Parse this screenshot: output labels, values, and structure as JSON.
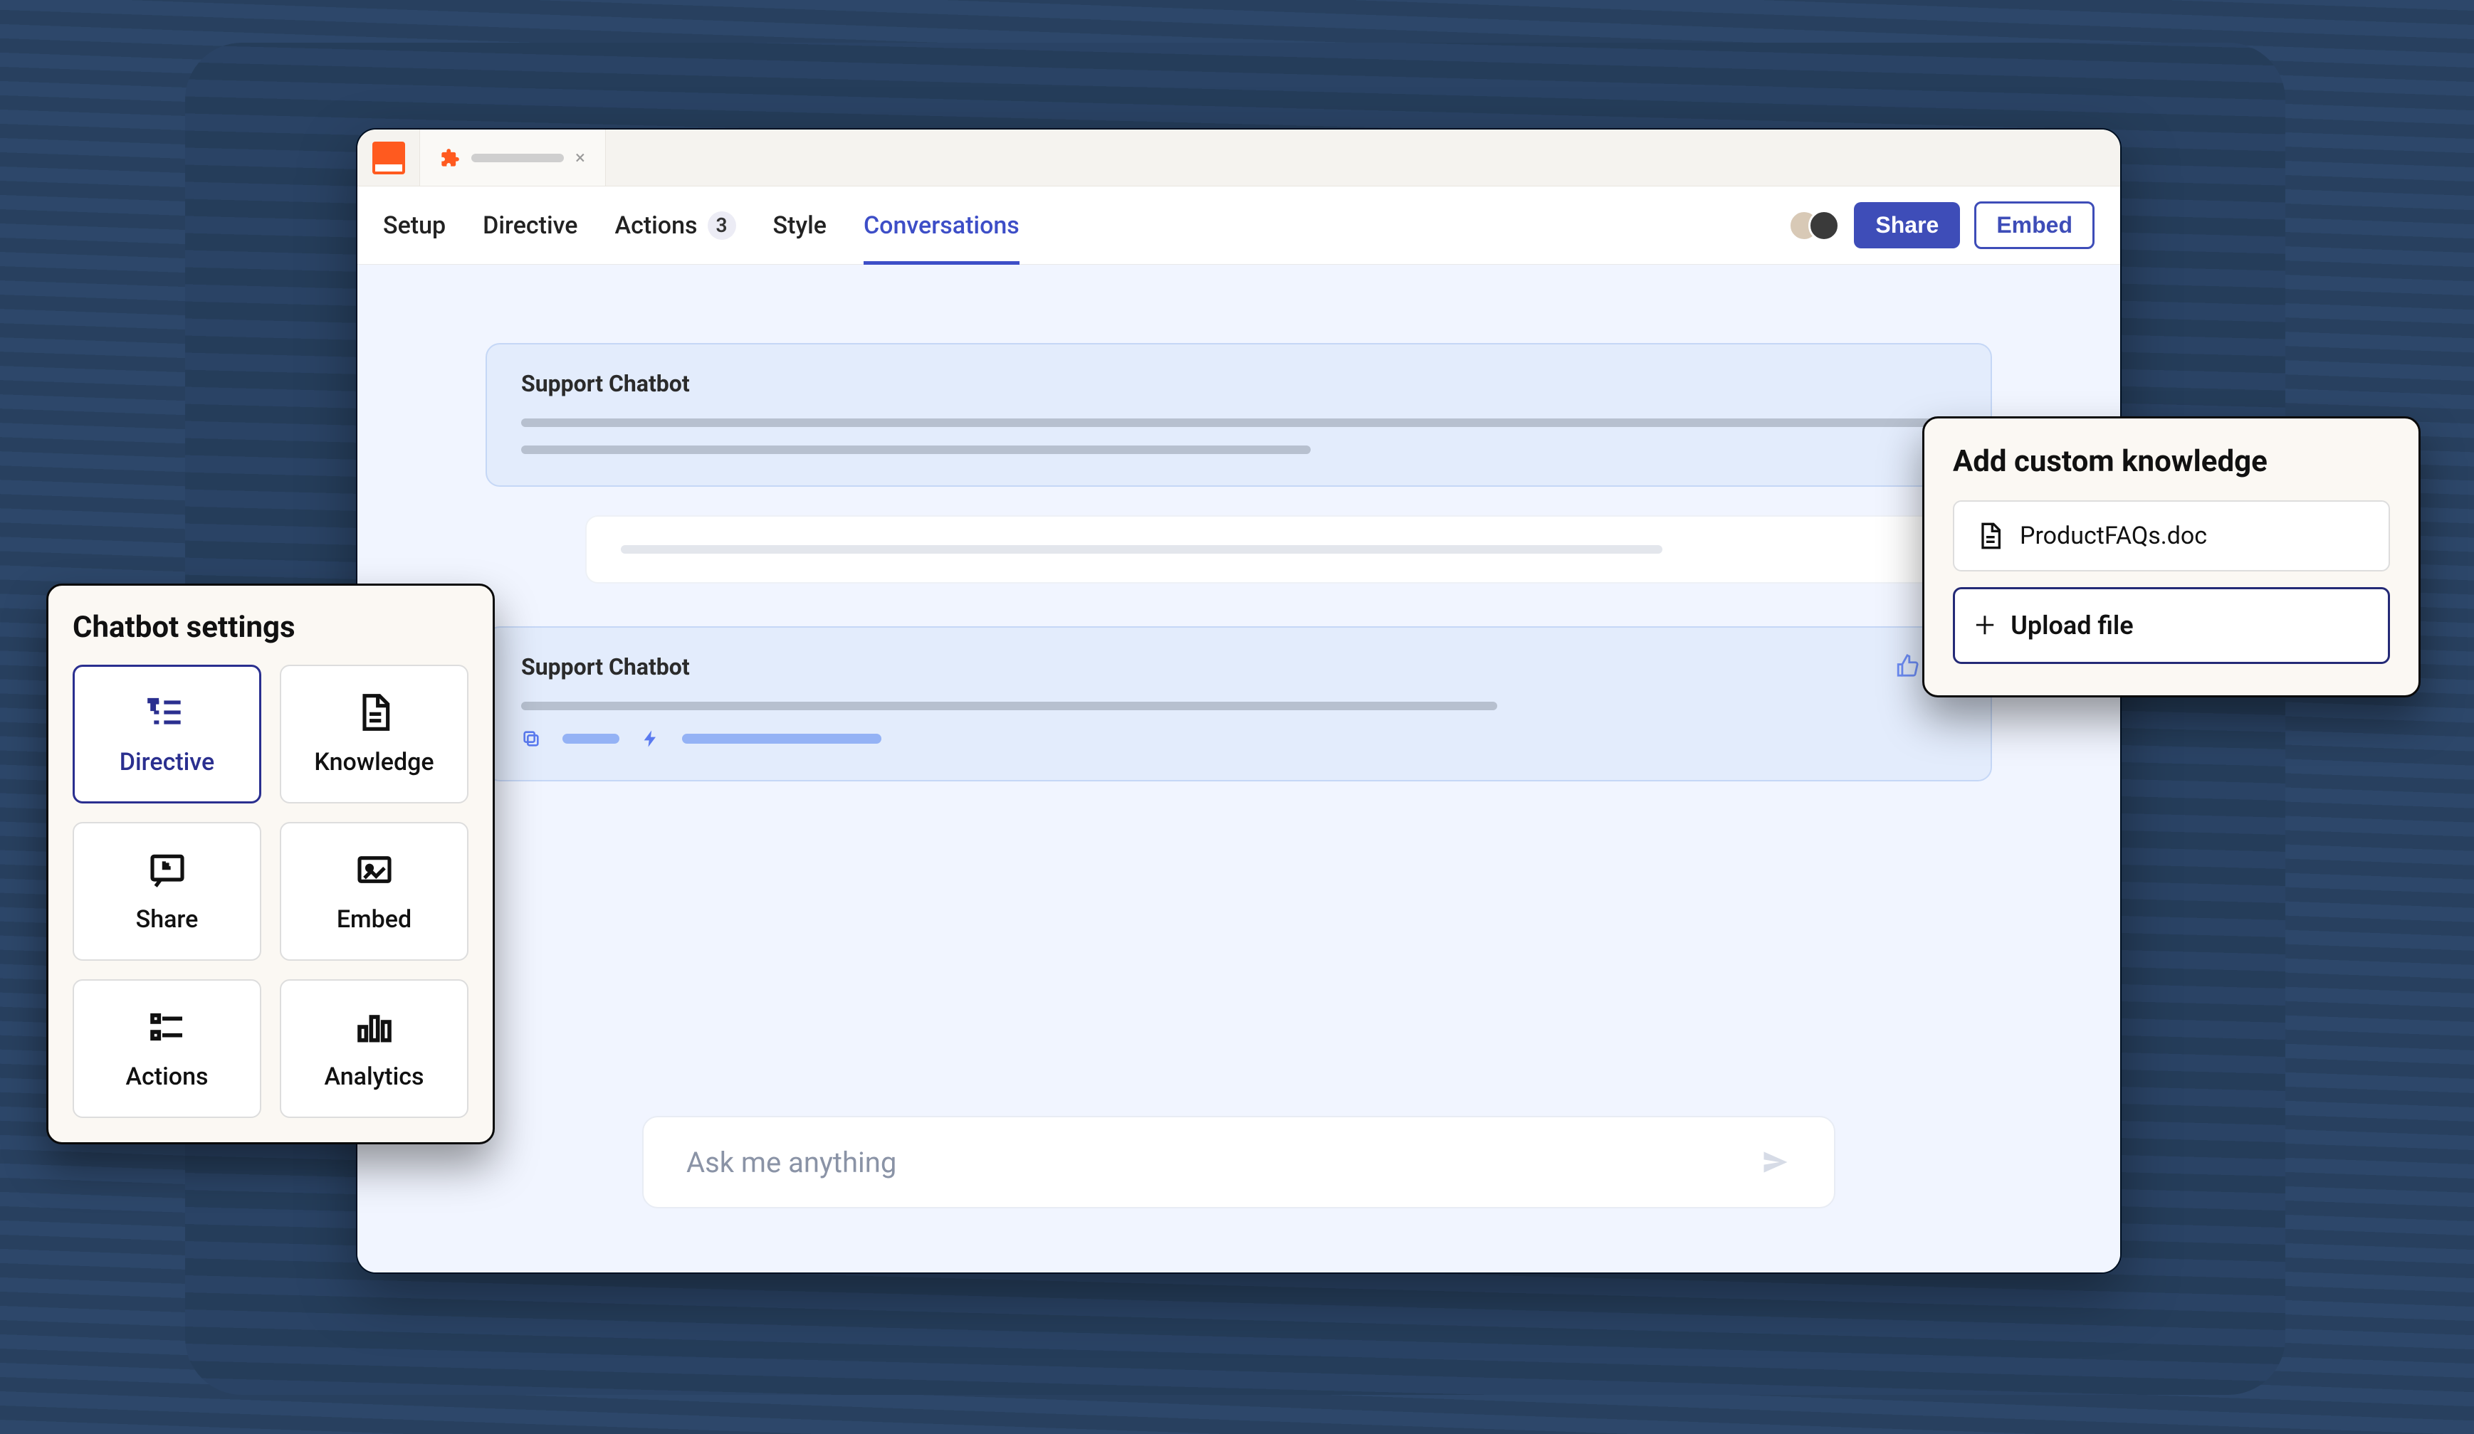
{
  "nav": {
    "tabs": [
      {
        "label": "Setup"
      },
      {
        "label": "Directive"
      },
      {
        "label": "Actions",
        "badge": "3"
      },
      {
        "label": "Style"
      },
      {
        "label": "Conversations",
        "active": true
      }
    ],
    "share_label": "Share",
    "embed_label": "Embed"
  },
  "chat": {
    "bot_name": "Support Chatbot",
    "input_placeholder": "Ask me anything"
  },
  "settings_panel": {
    "title": "Chatbot settings",
    "tiles": [
      {
        "label": "Directive",
        "active": true
      },
      {
        "label": "Knowledge"
      },
      {
        "label": "Share"
      },
      {
        "label": "Embed"
      },
      {
        "label": "Actions"
      },
      {
        "label": "Analytics"
      }
    ]
  },
  "knowledge_panel": {
    "title": "Add custom knowledge",
    "file_name": "ProductFAQs.doc",
    "upload_label": "Upload file"
  },
  "colors": {
    "accent": "#3e4db8",
    "brand_orange": "#ff5a1f"
  }
}
